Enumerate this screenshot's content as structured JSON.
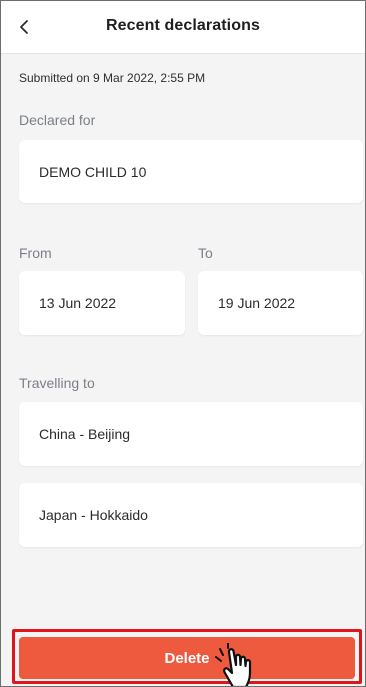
{
  "header": {
    "title": "Recent declarations",
    "back_icon": "chevron-left-icon"
  },
  "submitted_text": "Submitted on 9 Mar 2022, 2:55 PM",
  "declared_for": {
    "label": "Declared for",
    "value": "DEMO CHILD 10"
  },
  "dates": {
    "from_label": "From",
    "from_value": "13 Jun 2022",
    "to_label": "To",
    "to_value": "19 Jun 2022"
  },
  "travelling": {
    "label": "Travelling to",
    "destinations": [
      "China - Beijing",
      "Japan - Hokkaido"
    ]
  },
  "actions": {
    "delete_label": "Delete"
  },
  "colors": {
    "delete_bg": "#ee5a3e",
    "highlight_border": "#e0151b",
    "label_gray": "#7a7f87",
    "page_bg": "#f4f4f4"
  }
}
